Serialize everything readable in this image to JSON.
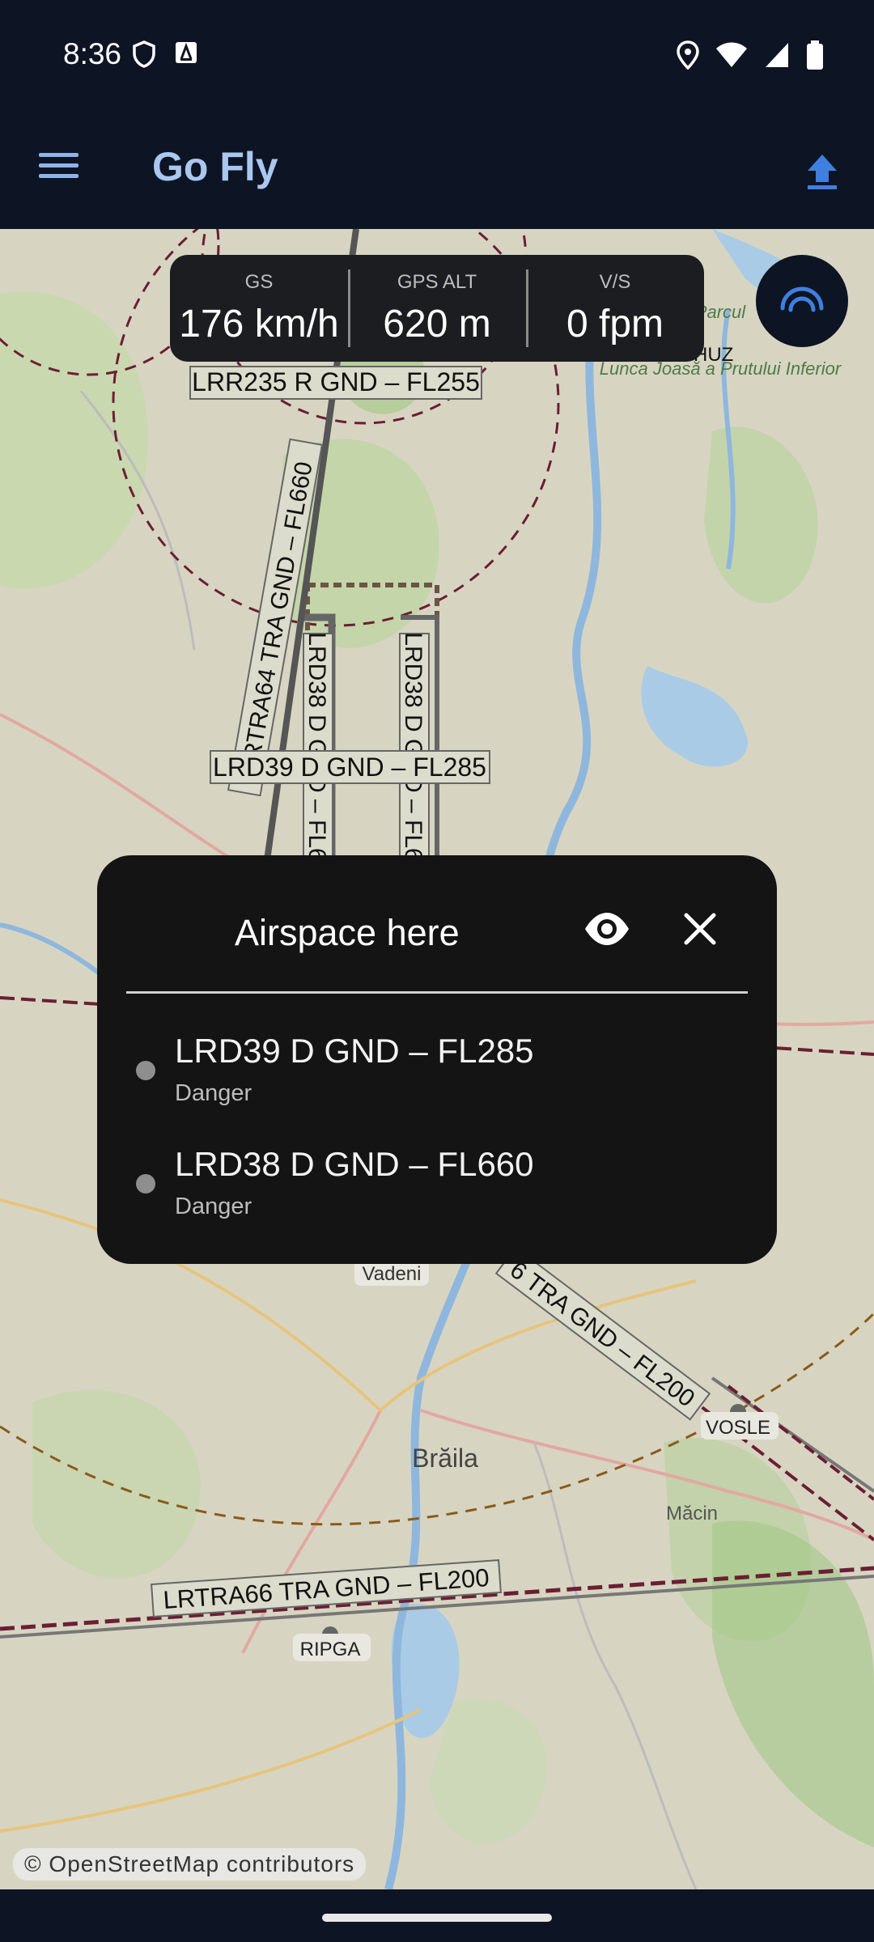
{
  "status_bar": {
    "time": "8:36"
  },
  "app_bar": {
    "title": "Go Fly"
  },
  "instruments": [
    {
      "label": "GS",
      "value": "176 km/h"
    },
    {
      "label": "GPS ALT",
      "value": "620 m"
    },
    {
      "label": "V/S",
      "value": "0 fpm"
    }
  ],
  "map": {
    "airspace_labels": [
      "LRR235 R GND – FL255",
      "LRTRA64 TRA GND – FL660",
      "LRD38 D GND – FL6",
      "LRD38 D GND – FL6",
      "LRD39 D GND – FL285",
      "6 TRA GND – FL200",
      "LRTRA66 TRA GND – FL200"
    ],
    "place_labels": [
      "USHUZ",
      "Vadeni",
      "Brăila",
      "Măcin",
      "VOSLE",
      "RIPGA",
      "Lunca Joasă a Prutului Inferior",
      "Parcul"
    ],
    "attribution": "© OpenStreetMap contributors"
  },
  "popup": {
    "title": "Airspace here",
    "items": [
      {
        "name": "LRD39 D GND – FL285",
        "type": "Danger"
      },
      {
        "name": "LRD38 D GND – FL660",
        "type": "Danger"
      }
    ]
  },
  "colors": {
    "background": "#0d1423",
    "title": "#a9c7ef",
    "accent": "#3f7fe0",
    "popup": "#141414",
    "danger_line": "#6b1e34"
  }
}
